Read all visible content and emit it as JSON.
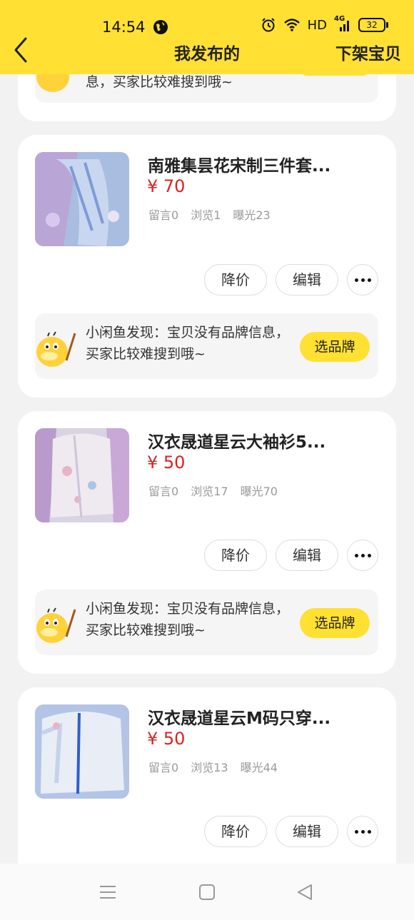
{
  "status_bar": {
    "time": "14:54",
    "network": "HD",
    "signal": "4G",
    "battery": "32"
  },
  "header": {
    "title": "我发布的",
    "right_action": "下架宝贝"
  },
  "tip_text": "小闲鱼发现：宝贝没有品牌信息，买家比较难搜到哦~",
  "tip_text_partial": "息，买家比较难搜到哦~",
  "brand_button": "选品牌",
  "items": [
    {
      "title": "南雅集昙花宋制三件套...",
      "price": "¥ 70",
      "comments": "留言0",
      "views": "浏览1",
      "exposure": "曝光23"
    },
    {
      "title": "汉衣晟道星云大袖衫5...",
      "price": "¥ 50",
      "comments": "留言0",
      "views": "浏览17",
      "exposure": "曝光70"
    },
    {
      "title": "汉衣晟道星云M码只穿...",
      "price": "¥ 50",
      "comments": "留言0",
      "views": "浏览13",
      "exposure": "曝光44"
    }
  ],
  "actions": {
    "price_cut": "降价",
    "edit": "编辑"
  },
  "colors": {
    "accent": "#ffe033",
    "price": "#e02020"
  }
}
